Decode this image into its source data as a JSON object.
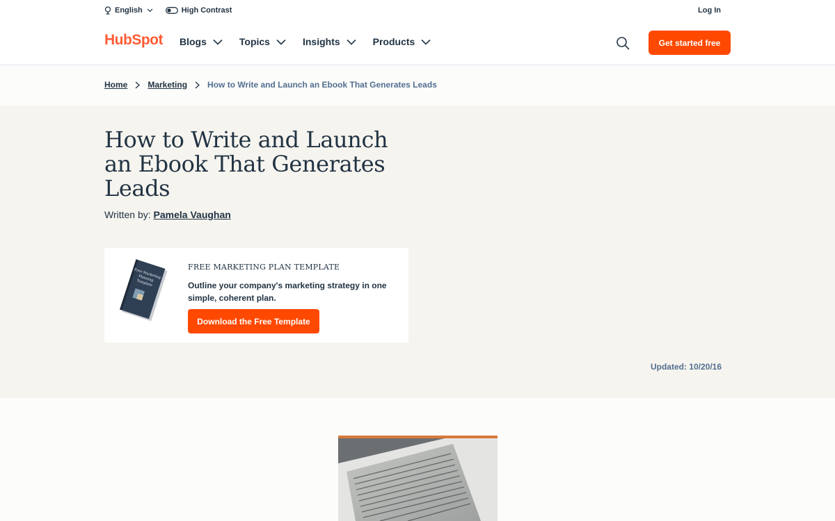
{
  "util_bar": {
    "language": "English",
    "contrast": "High Contrast",
    "login": "Log In"
  },
  "nav": {
    "logo": "HubSpot",
    "items": [
      "Blogs",
      "Topics",
      "Insights",
      "Products"
    ],
    "cta": "Get started free"
  },
  "breadcrumb": {
    "home": "Home",
    "section": "Marketing",
    "current": "How to Write and Launch an Ebook That Generates Leads"
  },
  "article": {
    "title": "How to Write and Launch an Ebook That Generates Leads",
    "byline_prefix": "Written by:",
    "author": "Pamela Vaughan",
    "updated": "Updated: 10/20/16"
  },
  "offer": {
    "eyebrow": "FREE MARKETING PLAN TEMPLATE",
    "description": "Outline your company's marketing strategy in one simple, coherent plan.",
    "button": "Download the Free Template",
    "book_cover_text": "Free Marketing Planning Template"
  },
  "colors": {
    "accent": "#ff4800",
    "brand": "#ff5c35",
    "text": "#213343",
    "hero_bg": "#f6f4ef"
  },
  "icons": {
    "language": "globe-icon",
    "contrast": "toggle-icon",
    "chevron": "chevron-down-icon",
    "search": "search-icon",
    "separator": "chevron-right-icon"
  }
}
